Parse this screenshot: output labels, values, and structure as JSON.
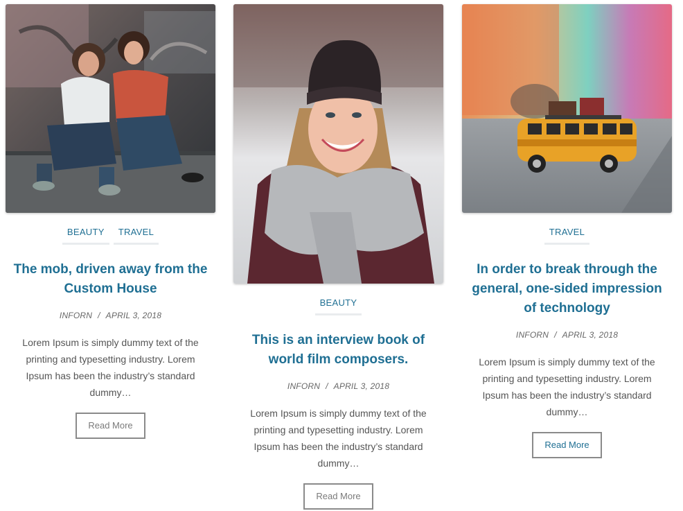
{
  "posts": [
    {
      "image_alt": "Two women sitting on a sidewalk against graffiti wall",
      "categories": [
        "BEAUTY",
        "TRAVEL"
      ],
      "title": "The mob, driven away from the Custom House",
      "author": "INFORN",
      "separator": "/",
      "date": "APRIL 3, 2018",
      "excerpt": "Lorem Ipsum is simply dummy text of the printing and typesetting industry. Lorem Ipsum has been the industry’s standard dummy…",
      "read_more": "Read More"
    },
    {
      "image_alt": "Smiling woman in beanie and scarf",
      "categories": [
        "BEAUTY"
      ],
      "title": "This is an interview book of world film composers.",
      "author": "INFORN",
      "separator": "/",
      "date": "APRIL 3, 2018",
      "excerpt": "Lorem Ipsum is simply dummy text of the printing and typesetting industry. Lorem Ipsum has been the industry’s standard dummy…",
      "read_more": "Read More"
    },
    {
      "image_alt": "Toy yellow bus with luggage on road",
      "categories": [
        "TRAVEL"
      ],
      "title": "In order to break through the general, one-sided impression of technology",
      "author": "INFORN",
      "separator": "/",
      "date": "APRIL 3, 2018",
      "excerpt": "Lorem Ipsum is simply dummy text of the printing and typesetting industry. Lorem Ipsum has been the industry’s standard dummy…",
      "read_more": "Read More"
    }
  ],
  "colors": {
    "accent": "#1f6f93",
    "text": "#555555",
    "meta": "#666666",
    "button_border": "#8a8a8a"
  }
}
